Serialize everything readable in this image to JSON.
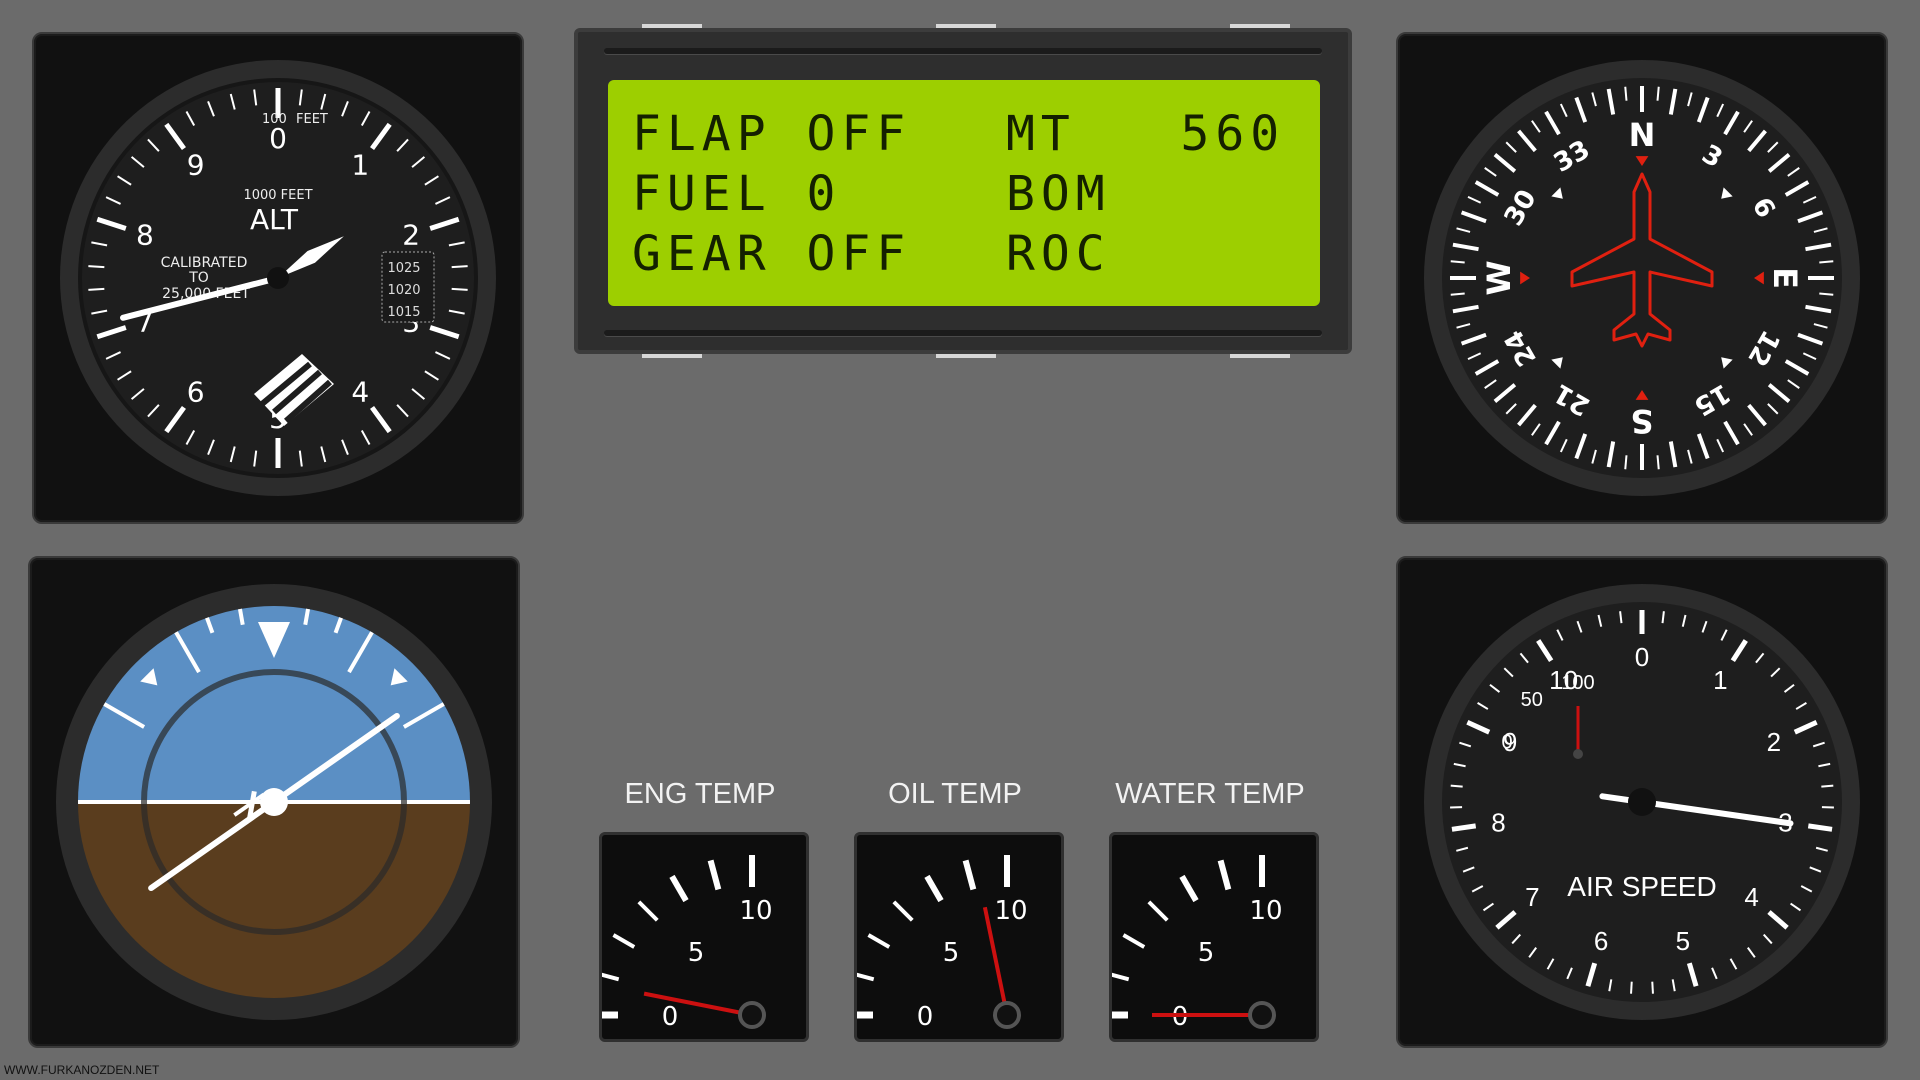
{
  "altimeter": {
    "top_label": "100",
    "top_unit": "FEET",
    "mid_label": "1000 FEET",
    "title": "ALT",
    "calibrated": "CALIBRATED",
    "to": "TO",
    "max_feet": "25,000 FEET",
    "kollsman": [
      "1025",
      "1020",
      "1015"
    ],
    "numbers": [
      "0",
      "1",
      "2",
      "3",
      "4",
      "5",
      "6",
      "7",
      "8",
      "9"
    ],
    "needle_hundreds": 7.1,
    "needle_thousands": 1.6
  },
  "lcd": {
    "row1_left": "FLAP OFF",
    "row1_right": "MT   560",
    "row2_left": "FUEL 0",
    "row2_right": "BOM",
    "row3_left": "GEAR OFF",
    "row3_right": "ROC",
    "colors": {
      "screen": "#9dcf00",
      "text": "#142000"
    }
  },
  "compass": {
    "labels": [
      "N",
      "3",
      "6",
      "E",
      "12",
      "15",
      "S",
      "21",
      "24",
      "W",
      "30",
      "33"
    ],
    "heading_deg": 0,
    "plane_color": "#e02010"
  },
  "attitude": {
    "sky_color": "#5b8fc4",
    "ground_color": "#5a3d1e",
    "roll_deg": -35
  },
  "temps": [
    {
      "label": "ENG TEMP",
      "scale": [
        "0",
        "5",
        "10"
      ],
      "needle_value": 1.4
    },
    {
      "label": "OIL TEMP",
      "scale": [
        "0",
        "5",
        "10"
      ],
      "needle_value": 9.8
    },
    {
      "label": "WATER TEMP",
      "scale": [
        "0",
        "5",
        "10"
      ],
      "needle_value": 0
    }
  ],
  "airspeed": {
    "title": "AIR SPEED",
    "numbers": [
      "0",
      "1",
      "2",
      "3",
      "4",
      "5",
      "6",
      "7",
      "8",
      "9",
      "10"
    ],
    "sub_numbers": [
      "0",
      "50",
      "100"
    ],
    "needle_value": 3,
    "sub_needle_value": 0
  },
  "watermark": "WWW.FURKANOZDEN.NET"
}
